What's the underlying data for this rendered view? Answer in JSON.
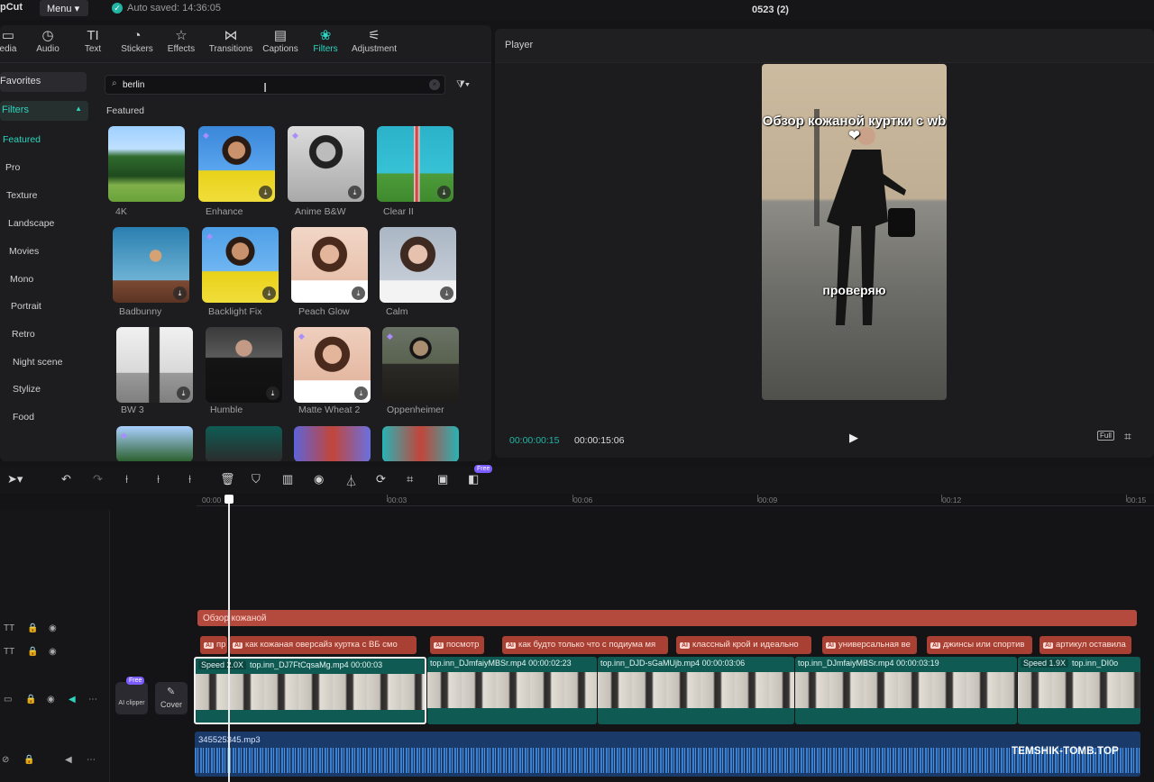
{
  "topbar": {
    "app": "pCut",
    "menu": "Menu",
    "saved": "Auto saved: 14:36:05",
    "project": "0523 (2)"
  },
  "tabs": [
    {
      "label": "edia",
      "icon": "media-icon"
    },
    {
      "label": "Audio",
      "icon": "audio-icon"
    },
    {
      "label": "Text",
      "icon": "text-icon"
    },
    {
      "label": "Stickers",
      "icon": "sticker-icon"
    },
    {
      "label": "Effects",
      "icon": "effects-icon"
    },
    {
      "label": "Transitions",
      "icon": "transitions-icon"
    },
    {
      "label": "Captions",
      "icon": "captions-icon"
    },
    {
      "label": "Filters",
      "icon": "filters-icon"
    },
    {
      "label": "Adjustment",
      "icon": "adjustment-icon"
    }
  ],
  "sidebar": {
    "favorites": "Favorites",
    "filters": "Filters",
    "items": [
      "Featured",
      "Pro",
      "Texture",
      "Landscape",
      "Movies",
      "Mono",
      "Portrait",
      "Retro",
      "Night scene",
      "Stylize",
      "Food"
    ]
  },
  "search": {
    "value": "berlin"
  },
  "section_title": "Featured",
  "filters": [
    "4K",
    "Enhance",
    "Anime B&W",
    "Clear II",
    "Badbunny",
    "Backlight Fix",
    "Peach Glow",
    "Calm",
    "BW 3",
    "Humble",
    "Matte Wheat 2",
    "Oppenheimer"
  ],
  "player": {
    "title": "Player",
    "overlay_top": "Обзор кожаной куртки с wb ❤",
    "overlay_bottom": "проверяю",
    "time_current": "00:00:00:15",
    "time_total": "00:00:15:06",
    "full": "Full"
  },
  "toolbar": {
    "free": "Free"
  },
  "ruler": [
    "00:00",
    "00:03",
    "00:06",
    "00:09",
    "00:12",
    "00:15"
  ],
  "timeline": {
    "ai_badge": "Free",
    "ai_label": "AI clipper",
    "cover_label": "Cover",
    "text_track": "Обзор кожаной",
    "subtitles": [
      "пр",
      "как кожаная оверсайз куртка с ВБ смо",
      "посмотр",
      "как будто только что с подиума мя",
      "классный крой и идеально",
      "универсальная ве",
      "джинсы или спортив",
      "артикул оставила"
    ],
    "clips": [
      {
        "speed": "Speed 2.0X",
        "name": "top.inn_DJ7FtCqsaMg.mp4",
        "dur": "00:00:03"
      },
      {
        "speed": "",
        "name": "top.inn_DJmfaiyMBSr.mp4",
        "dur": "00:00:02:23"
      },
      {
        "speed": "",
        "name": "top.inn_DJD-sGaMUjb.mp4",
        "dur": "00:00:03:06"
      },
      {
        "speed": "",
        "name": "top.inn_DJmfaiyMBSr.mp4",
        "dur": "00:00:03:19"
      },
      {
        "speed": "Speed 1.9X",
        "name": "top.inn_DI0o",
        "dur": ""
      }
    ],
    "audio": "345525345.mp3"
  },
  "watermark": "TEMSHIK-TOMB.TOP",
  "colors": {
    "accent": "#2dd4bf",
    "text_track": "#b44a3e",
    "video_track": "#0f5b54",
    "audio_track": "#1a3a6a",
    "premium": "#7b5cff"
  }
}
